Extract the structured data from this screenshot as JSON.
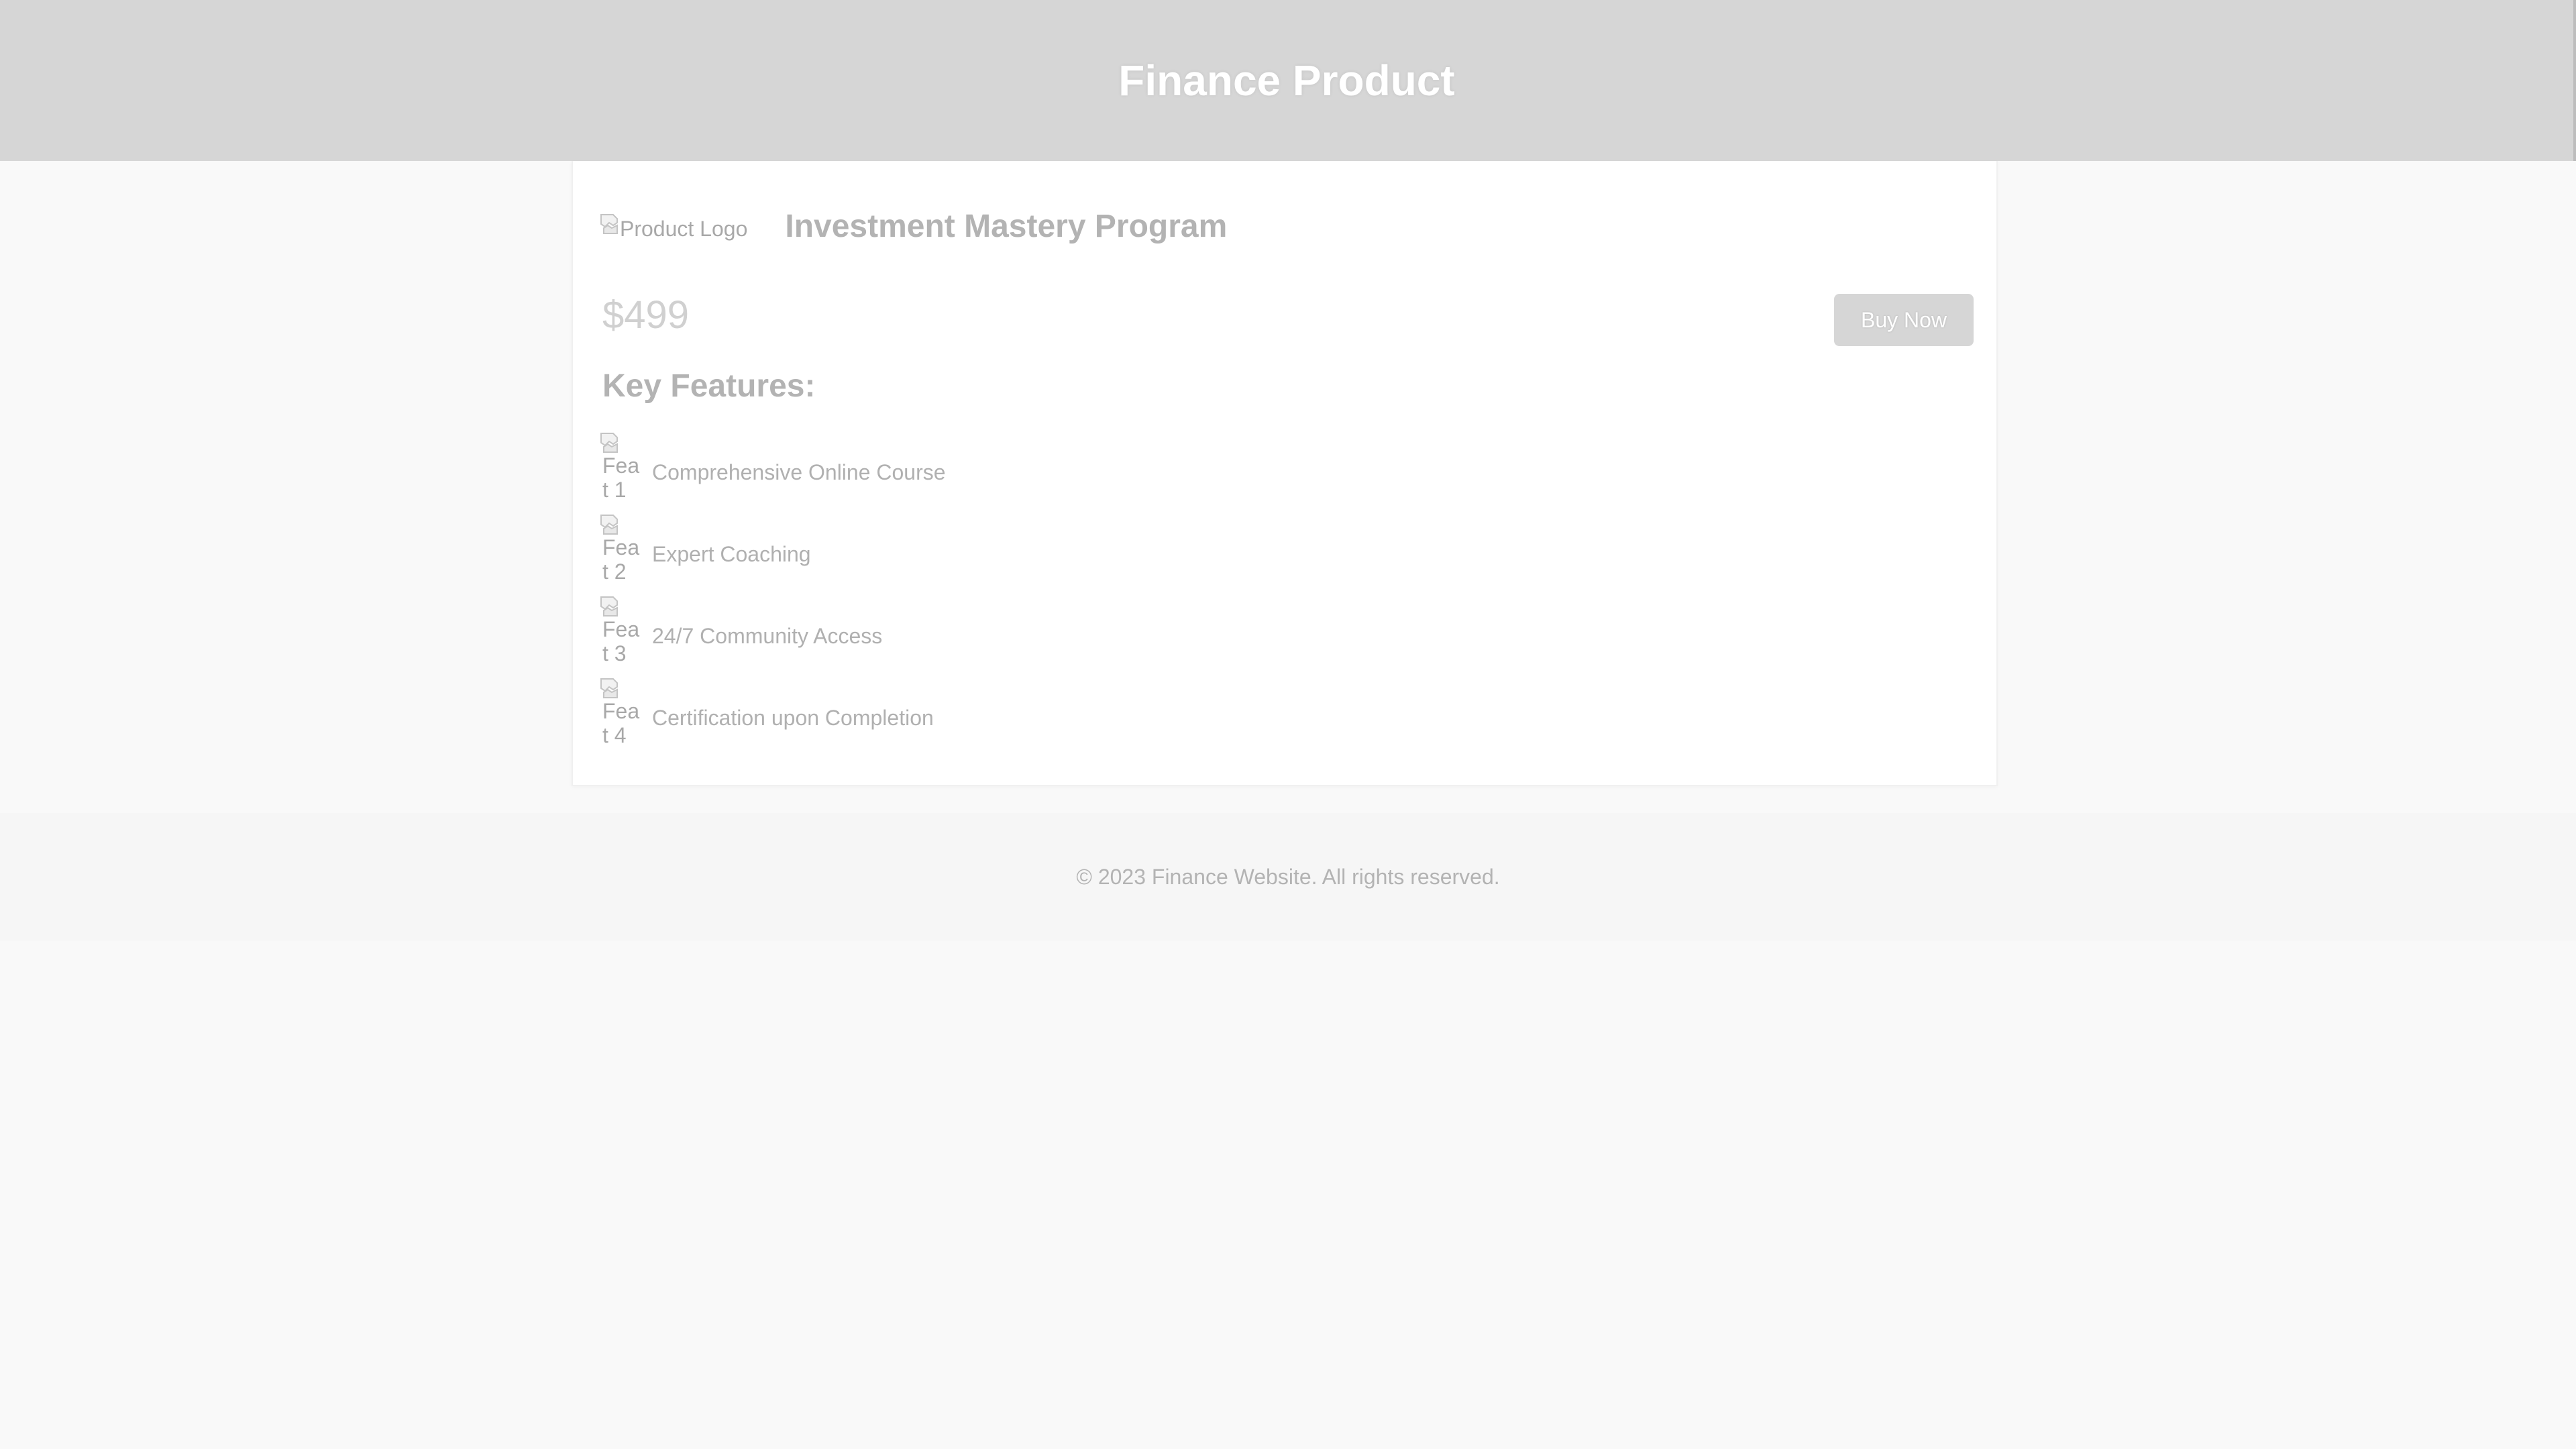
{
  "header": {
    "title": "Finance Product"
  },
  "product": {
    "logo_alt": "Product Logo",
    "name": "Investment Mastery Program",
    "price": "$499",
    "buy_label": "Buy Now"
  },
  "features": {
    "title": "Key Features:",
    "items": [
      {
        "icon_alt": "Feat 1",
        "label": "Comprehensive Online Course"
      },
      {
        "icon_alt": "Feat 2",
        "label": "Expert Coaching"
      },
      {
        "icon_alt": "Feat 3",
        "label": "24/7 Community Access"
      },
      {
        "icon_alt": "Feat 4",
        "label": "Certification upon Completion"
      }
    ]
  },
  "footer": {
    "text": "© 2023 Finance Website. All rights reserved."
  },
  "colors": {
    "header_bg": "#d6d6d6",
    "button_bg": "#d6d6d6",
    "page_bg": "#f9f9f9"
  },
  "icons": {
    "logo": "broken-image-icon",
    "feature": "broken-image-icon"
  }
}
